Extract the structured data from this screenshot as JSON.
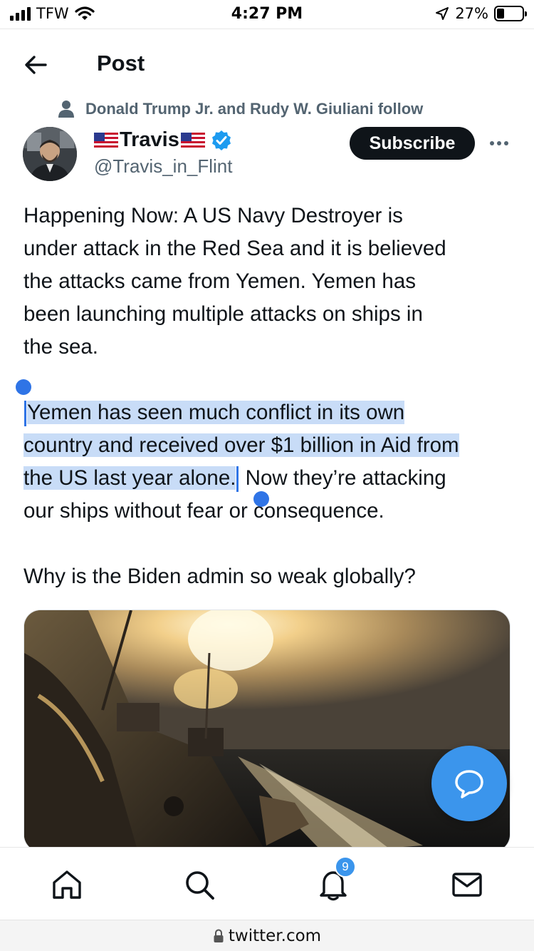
{
  "status_bar": {
    "carrier": "TFW",
    "time": "4:27 PM",
    "battery": "27%"
  },
  "header": {
    "title": "Post"
  },
  "social_context": "Donald Trump Jr. and Rudy W. Giuliani follow",
  "author": {
    "name": "Travis",
    "handle": "@Travis_in_Flint"
  },
  "actions": {
    "subscribe_label": "Subscribe"
  },
  "tweet": {
    "para1": "Happening Now:  A US Navy Destroyer is\nunder attack in the Red Sea and it is believed\nthe attacks came from Yemen.  Yemen has\nbeen launching multiple attacks on ships in\nthe sea.",
    "para2_selected": "Yemen has seen much conflict in its own\ncountry and received over $1 billion in Aid from\nthe US last year alone.",
    "para2_rest": "Now they’re attacking\nour ships without fear or consequence.",
    "para3": "Why is the Biden admin so weak globally?"
  },
  "bottom_nav": {
    "notifications_count": "9"
  },
  "url_bar": {
    "url": "twitter.com"
  },
  "colors": {
    "accent": "#3b95ec",
    "selection": "#c8dcf7",
    "text": "#0f1419",
    "secondary_text": "#536471"
  },
  "icons": [
    "back-arrow-icon",
    "person-icon",
    "verified-badge-icon",
    "more-dots-icon",
    "compose-reply-icon",
    "home-icon",
    "search-icon",
    "bell-icon",
    "mail-icon",
    "lock-icon",
    "wifi-icon",
    "location-arrow-icon",
    "battery-icon",
    "signal-icon",
    "us-flag-icon"
  ]
}
